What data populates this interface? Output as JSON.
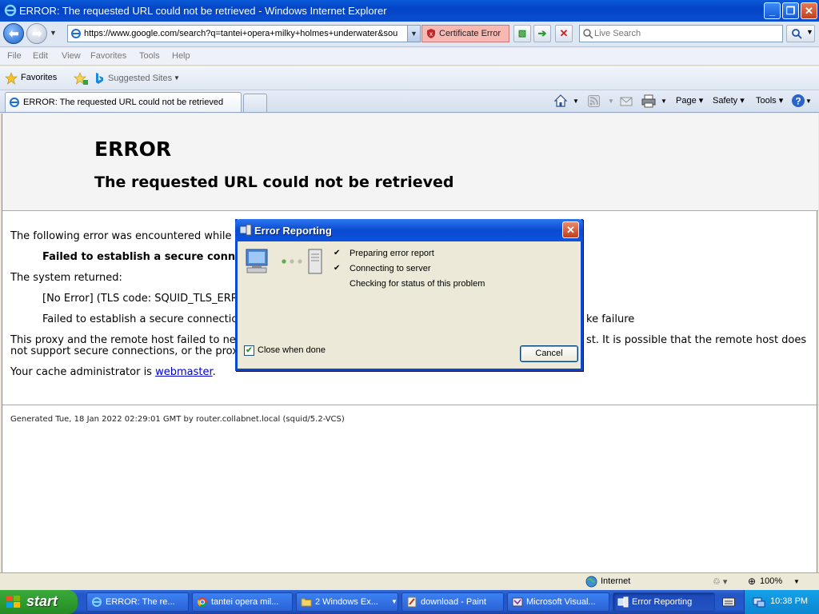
{
  "window": {
    "title": "ERROR: The requested URL could not be retrieved - Windows Internet Explorer"
  },
  "address": {
    "url": "https://www.google.com/search?q=tantei+opera+milky+holmes+underwater&sou",
    "cert_error": "Certificate Error",
    "search_placeholder": "Live Search"
  },
  "menu": [
    "File",
    "Edit",
    "View",
    "Favorites",
    "Tools",
    "Help"
  ],
  "favorites": {
    "label": "Favorites",
    "suggested": "Suggested Sites"
  },
  "tab": {
    "label": "ERROR: The requested URL could not be retrieved"
  },
  "commands": {
    "page": "Page",
    "safety": "Safety",
    "tools": "Tools"
  },
  "page": {
    "h1": "ERROR",
    "h2": "The requested URL could not be retrieved",
    "p1": "The following error was encountered while tr",
    "p2": "Failed to establish a secure connecti",
    "p3": "The system returned:",
    "p4": "[No Error] (TLS code: SQUID_TLS_ERR_",
    "p5a": "Failed to establish a secure connection",
    "p5b": "ke failure",
    "p6a": "This proxy and the remote host failed to neg",
    "p6b": "st. It is possible that the remote host does",
    "p7": "not support secure connections, or the proxy",
    "cache_prefix": "Your cache administrator is ",
    "cache_link": "webmaster",
    "cache_suffix": ".",
    "generated": "Generated Tue, 18 Jan 2022 02:29:01 GMT by router.collabnet.local (squid/5.2-VCS)"
  },
  "dialog": {
    "title": "Error Reporting",
    "steps": [
      {
        "label": "Preparing error report",
        "done": "✔"
      },
      {
        "label": "Connecting to server",
        "done": "✔"
      },
      {
        "label": "Checking for status of this problem",
        "done": ""
      }
    ],
    "close_when_done": "Close when done",
    "cancel": "Cancel"
  },
  "status": {
    "zone": "Internet",
    "zoom": "100%"
  },
  "taskbar": {
    "start": "start",
    "tasks": [
      "ERROR: The re...",
      "tantei opera mil...",
      "2 Windows Ex...",
      "download - Paint",
      "Microsoft Visual...",
      "Error Reporting"
    ],
    "clock": "10:38 PM"
  },
  "colors": {
    "titlebar": "#0a4fd1",
    "cert_error_bg": "#f7b9b4",
    "link": "#0000cc",
    "taskbar": "#245ace",
    "start": "#2f9c2f"
  }
}
